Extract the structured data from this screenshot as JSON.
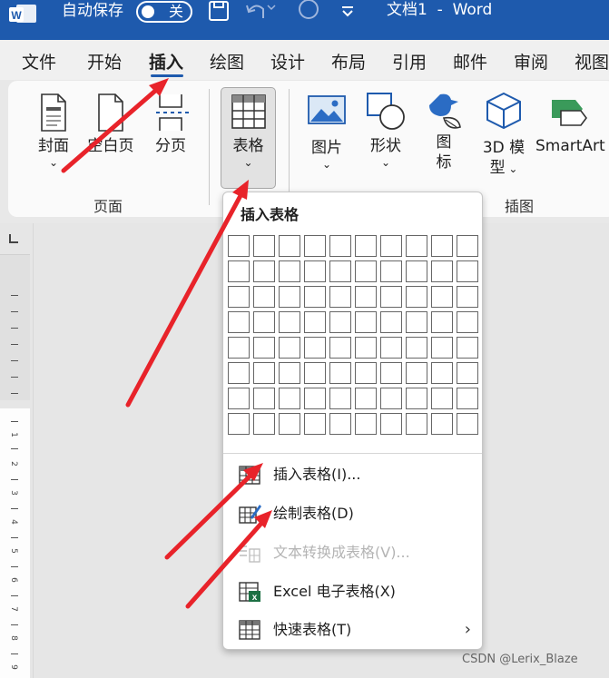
{
  "titlebar": {
    "autosave_label": "自动保存",
    "autosave_state": "关",
    "doc_title": "文档1  -  Word",
    "icons": [
      "word-logo-icon",
      "save-icon",
      "undo-icon",
      "redo-icon",
      "customize-qat-icon"
    ]
  },
  "tabs": [
    "文件",
    "开始",
    "插入",
    "绘图",
    "设计",
    "布局",
    "引用",
    "邮件",
    "审阅",
    "视图"
  ],
  "active_tab": "插入",
  "ribbon": {
    "pages_group": {
      "label": "页面",
      "cover": "封面",
      "blank_page": "空白页",
      "page_break": "分页"
    },
    "table_button": "表格",
    "illustrations_group": {
      "label": "插图",
      "picture": "图片",
      "shape": "形状",
      "icon_top": "图",
      "icon_bottom": "标",
      "model_top": "3D 模",
      "model_bottom": "型",
      "smartart": "SmartArt"
    }
  },
  "table_menu": {
    "title": "插入表格",
    "grid_columns": 10,
    "grid_rows": 8,
    "items": [
      {
        "label": "插入表格(I)...",
        "enabled": true,
        "icon": "insert-table-icon"
      },
      {
        "label": "绘制表格(D)",
        "enabled": true,
        "icon": "draw-table-icon"
      },
      {
        "label": "文本转换成表格(V)...",
        "enabled": false,
        "icon": "convert-text-icon"
      },
      {
        "label": "Excel 电子表格(X)",
        "enabled": true,
        "icon": "excel-icon"
      },
      {
        "label": "快速表格(T)",
        "enabled": true,
        "icon": "quick-table-icon",
        "submenu": true
      }
    ]
  },
  "ruler_numbers": [
    "1",
    "2",
    "3",
    "4",
    "5",
    "6",
    "7",
    "8",
    "9"
  ],
  "watermark": "CSDN @Lerix_Blaze",
  "colors": {
    "titlebar": "#1e5aad",
    "annotation_arrow": "#e8232a",
    "excel_green": "#1d7044"
  }
}
